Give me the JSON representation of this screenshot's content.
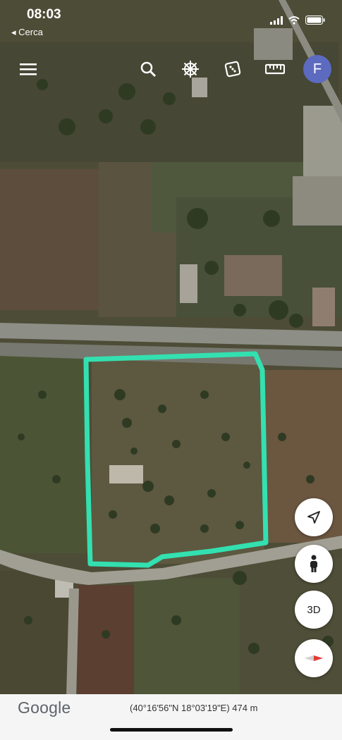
{
  "status_bar": {
    "time": "08:03",
    "back_label": "◂ Cerca",
    "icons": [
      "cellular-signal-icon",
      "wifi-icon",
      "battery-icon"
    ]
  },
  "toolbar": {
    "icons": [
      "menu-icon",
      "search-icon",
      "voyager-wheel-icon",
      "dice-icon",
      "ruler-icon"
    ],
    "avatar_letter": "F",
    "avatar_color": "#5c6bc0"
  },
  "map_controls": {
    "my_location_icon": "location-arrow-icon",
    "street_view_icon": "pegman-icon",
    "three_d_label": "3D",
    "compass_icon": "compass-icon"
  },
  "footer": {
    "logo_text": "Google",
    "coordinates": "(40°16'56\"N 18°03'19\"E) 474 m"
  },
  "colors": {
    "highlight_outline": "#33e0b0",
    "road": "#9a9a90",
    "field": "#5a5a3e"
  }
}
